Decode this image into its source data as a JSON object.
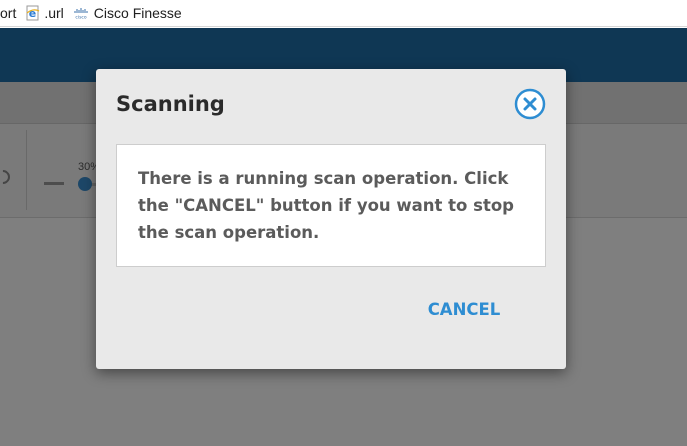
{
  "bookmarks": {
    "items": [
      {
        "label": "ort",
        "icon": ""
      },
      {
        "label": ".url",
        "icon": "ie-page-icon"
      },
      {
        "label": "Cisco Finesse",
        "icon": "cisco-logo-icon"
      }
    ]
  },
  "background_app": {
    "slider_label": "30%"
  },
  "dialog": {
    "title": "Scanning",
    "message": "There is a running scan operation. Click the \"CANCEL\" button if you want to stop the scan operation.",
    "cancel_label": "CANCEL",
    "close_icon": "close-circle-icon"
  },
  "colors": {
    "accent": "#2e8dd2",
    "header": "#1f6ea8",
    "dialog_bg": "#e9e9e9"
  }
}
